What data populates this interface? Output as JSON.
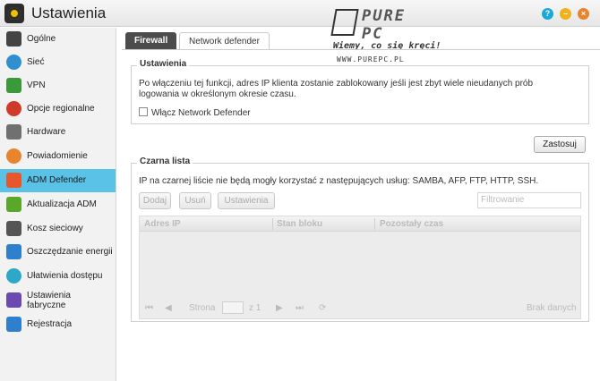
{
  "window": {
    "title": "Ustawienia",
    "help_icon": "?",
    "minimize_icon": "–",
    "close_icon": "×"
  },
  "watermark": {
    "brand": "PURE PC",
    "tagline": "Wiemy, co się kręci!",
    "url": "WWW.PUREPC.PL"
  },
  "sidebar": {
    "items": [
      {
        "label": "Ogólne",
        "icon": "server-icon",
        "color": "#444444"
      },
      {
        "label": "Sieć",
        "icon": "globe-icon",
        "color": "#2f8fcf"
      },
      {
        "label": "VPN",
        "icon": "house-network-icon",
        "color": "#3a9a3a"
      },
      {
        "label": "Opcje regionalne",
        "icon": "location-pin-icon",
        "color": "#d03a2a"
      },
      {
        "label": "Hardware",
        "icon": "wrench-icon",
        "color": "#707070"
      },
      {
        "label": "Powiadomienie",
        "icon": "alert-icon",
        "color": "#e8842c"
      },
      {
        "label": "ADM Defender",
        "icon": "shield-wall-icon",
        "color": "#e8562c"
      },
      {
        "label": "Aktualizacja ADM",
        "icon": "up-arrow-icon",
        "color": "#5aa82a"
      },
      {
        "label": "Kosz sieciowy",
        "icon": "trash-icon",
        "color": "#555555"
      },
      {
        "label": "Oszczędzanie energii",
        "icon": "energy-icon",
        "color": "#2f7fcf"
      },
      {
        "label": "Ułatwienia dostępu",
        "icon": "cloud-icon",
        "color": "#2fa8c8"
      },
      {
        "label": "Ustawienia fabryczne",
        "icon": "undo-icon",
        "color": "#6a4ab0"
      },
      {
        "label": "Rejestracja",
        "icon": "register-icon",
        "color": "#2f7fcf"
      }
    ]
  },
  "tabs": {
    "firewall": "Firewall",
    "network_defender": "Network defender"
  },
  "settings_section": {
    "legend": "Ustawienia",
    "description": "Po włączeniu tej funkcji, adres IP klienta zostanie zablokowany jeśli jest zbyt wiele nieudanych prób logowania w określonym okresie czasu.",
    "checkbox_label": "Włącz Network Defender"
  },
  "apply_button": "Zastosuj",
  "blacklist_section": {
    "legend": "Czarna lista",
    "info": "IP na czarnej liście nie będą mogły korzystać z następujących usług: SAMBA, AFP, FTP, HTTP, SSH.",
    "buttons": {
      "add": "Dodaj",
      "delete": "Usuń",
      "settings": "Ustawienia"
    },
    "filter_placeholder": "Filtrowanie",
    "columns": [
      "Adres IP",
      "Stan bloku",
      "Pozostały czas"
    ],
    "pager": {
      "first": "⏮",
      "prev": "◀",
      "page_label": "Strona",
      "of_label": "z 1",
      "next": "▶",
      "last": "⏭",
      "refresh": "⟳",
      "empty": "Brak danych"
    }
  }
}
